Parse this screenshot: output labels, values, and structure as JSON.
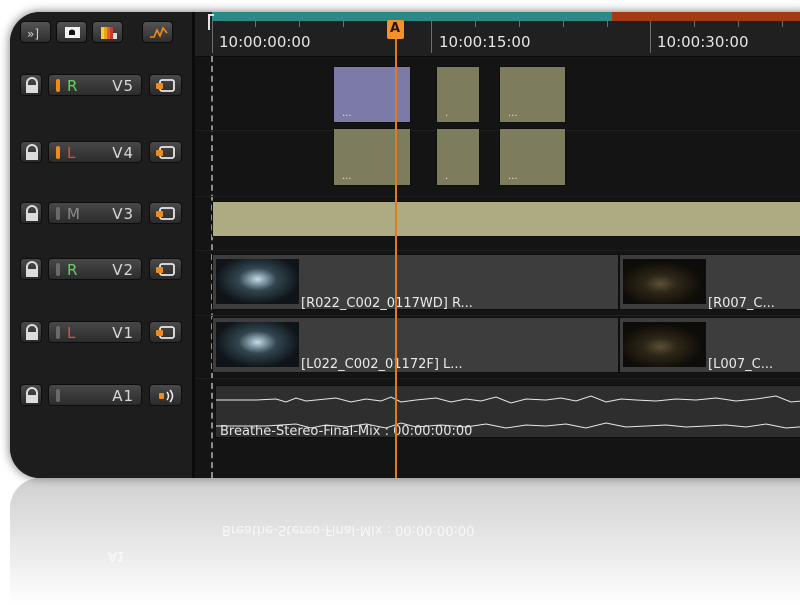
{
  "toolbar": {
    "buttons": [
      {
        "name": "jump-to-end-icon",
        "glyph": "»]"
      },
      {
        "name": "monitor-icon"
      },
      {
        "name": "color-bars-icon"
      },
      {
        "name": "waveform-icon"
      }
    ]
  },
  "timecodes": [
    "10:00:00:00",
    "10:00:15:00",
    "10:00:30:00"
  ],
  "playhead": {
    "label": "A"
  },
  "tracks": [
    {
      "eye": "R",
      "name": "V5",
      "eye_color": "#5ed45e",
      "indicator_on": true
    },
    {
      "eye": "L",
      "name": "V4",
      "eye_color": "#e0503c",
      "indicator_on": true
    },
    {
      "eye": "M",
      "name": "V3",
      "eye_color": "#8a8a8a",
      "indicator_on": false
    },
    {
      "eye": "R",
      "name": "V2",
      "eye_color": "#5ed45e",
      "indicator_on": false
    },
    {
      "eye": "L",
      "name": "V1",
      "eye_color": "#e0503c",
      "indicator_on": false
    },
    {
      "eye": "",
      "name": "A1",
      "eye_color": "#8a8a8a",
      "indicator_on": false
    }
  ],
  "clips": {
    "v5": [
      {
        "dots": "...",
        "color": "#7c7aa6"
      },
      {
        "dots": ".",
        "color": "#7d7d5e"
      },
      {
        "dots": "...",
        "color": "#7d7d5e"
      }
    ],
    "v4": [
      {
        "dots": "...",
        "color": "#7d7d5e"
      },
      {
        "dots": ".",
        "color": "#7d7d5e"
      },
      {
        "dots": "...",
        "color": "#7d7d5e"
      }
    ],
    "v3_color": "#aeaa82",
    "v2": [
      {
        "label": "[R022_C002_0117WD] R..."
      },
      {
        "label": "[R007_C..."
      }
    ],
    "v1": [
      {
        "label": "[L022_C002_01172F] L..."
      },
      {
        "label": "[L007_C..."
      }
    ],
    "audio": {
      "label": "Breathe-Stereo-Final-Mix : 00:00:00:00"
    }
  },
  "reflection": {
    "audio_label": "Breathe-Stereo-Final-Mix : 00:00:00:00",
    "track_name": "A1"
  },
  "colors": {
    "accent_orange": "#f08a1c",
    "ruler_teal": "#2c8a86",
    "ruler_red": "#a53a12"
  }
}
